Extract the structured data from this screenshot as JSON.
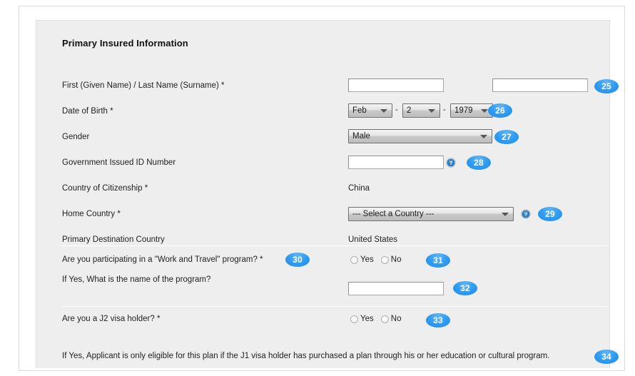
{
  "form": {
    "section_title": "Primary Insured Information",
    "labels": {
      "name": "First (Given Name) / Last Name (Surname) *",
      "dob": "Date of Birth *",
      "gender": "Gender",
      "gov_id": "Government Issued ID Number",
      "citizenship": "Country of Citizenship *",
      "home_country": "Home Country *",
      "destination_country": "Primary Destination Country",
      "work_travel": "Are you participating in a \"Work and Travel\" program? *",
      "program_name": "If Yes, What is the name of the program?",
      "j2_visa": "Are you a J2 visa holder? *",
      "j2_note": "If Yes, Applicant is only eligible for this plan if the J1 visa holder has purchased a plan through his or her education or cultural program."
    },
    "fields": {
      "first_name": {
        "value": "",
        "placeholder": ""
      },
      "last_name": {
        "value": "",
        "placeholder": ""
      },
      "dob_month": "Feb",
      "dob_day": "2",
      "dob_year": "1979",
      "dob_separator": "-",
      "gender": "Male",
      "gov_id": {
        "value": "",
        "placeholder": ""
      },
      "citizenship_value": "China",
      "home_country": "--- Select a Country ---",
      "destination_country_value": "United States",
      "program_name_input": {
        "value": "",
        "placeholder": ""
      }
    },
    "radio_options": {
      "yes": "Yes",
      "no": "No"
    },
    "icons": {
      "help": "help-icon",
      "dropdown": "chevron-down-icon"
    }
  },
  "badges": [
    {
      "id": "25",
      "label": "25"
    },
    {
      "id": "26",
      "label": "26"
    },
    {
      "id": "27",
      "label": "27"
    },
    {
      "id": "28",
      "label": "28"
    },
    {
      "id": "29",
      "label": "29"
    },
    {
      "id": "30",
      "label": "30"
    },
    {
      "id": "31",
      "label": "31"
    },
    {
      "id": "32",
      "label": "32"
    },
    {
      "id": "33",
      "label": "33"
    },
    {
      "id": "34",
      "label": "34"
    }
  ],
  "colors": {
    "badge_blue": "#2e9bf0",
    "panel_bg": "#eeeeee",
    "page_bg": "#ffffff",
    "help_icon_blue": "#2b7fc4"
  }
}
